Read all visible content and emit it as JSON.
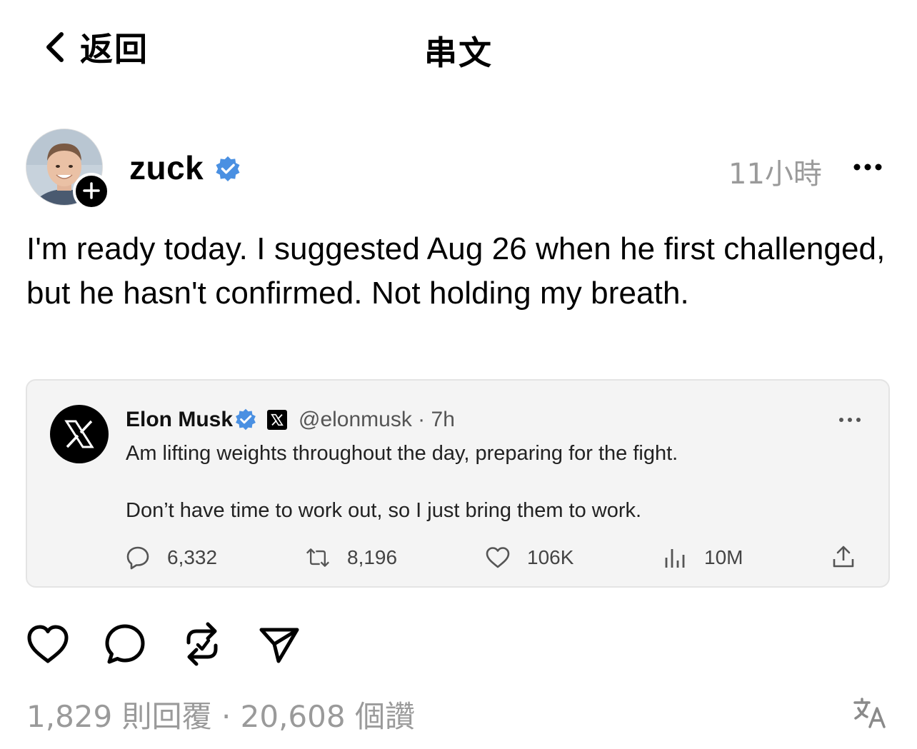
{
  "header": {
    "back_label": "返回",
    "title": "串文"
  },
  "post": {
    "author": "zuck",
    "verified": true,
    "time": "11小時",
    "text": "I'm ready today. I suggested Aug 26 when he first challenged, but he hasn't confirmed. Not holding my breath."
  },
  "quote": {
    "name": "Elon Musk",
    "handle": "@elonmusk · 7h",
    "line1": "Am lifting weights throughout the day, preparing for the fight.",
    "line2": "Don’t have time to work out, so I just bring them to work.",
    "stats": {
      "replies": "6,332",
      "reposts": "8,196",
      "likes": "106K",
      "views": "10M"
    }
  },
  "footer": {
    "stats_text": "1,829 則回覆 · 20,608 個讚"
  },
  "colors": {
    "verified_blue": "#4a90e2",
    "muted_gray": "#9a9a9a",
    "card_bg": "#f4f4f4"
  },
  "icons": {
    "back": "chevron-left-icon",
    "verified": "verified-badge-icon",
    "more": "more-horizontal-icon",
    "like": "heart-icon",
    "comment": "comment-icon",
    "repost": "repost-icon",
    "share": "send-icon",
    "translate": "translate-icon"
  }
}
